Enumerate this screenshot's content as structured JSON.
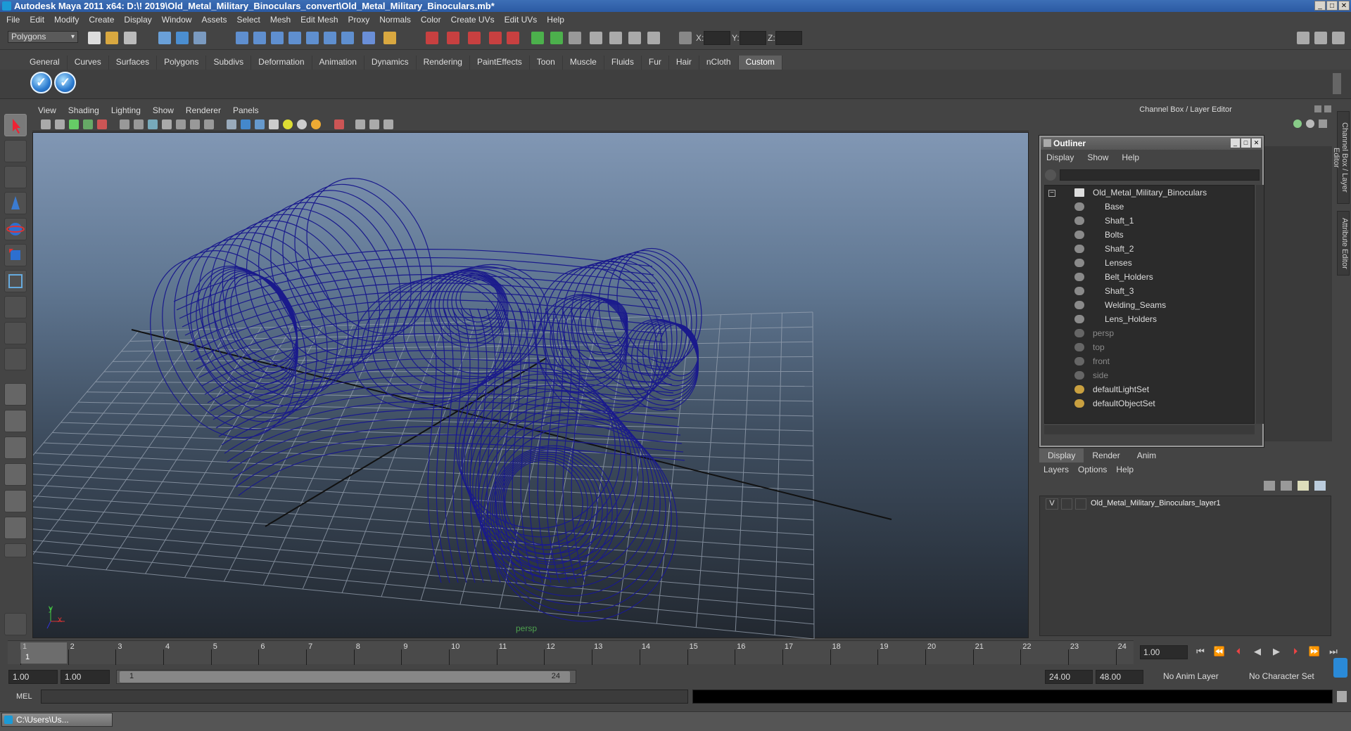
{
  "window": {
    "title": "Autodesk Maya 2011 x64: D:\\! 2019\\Old_Metal_Military_Binoculars_convert\\Old_Metal_Military_Binoculars.mb*"
  },
  "menubar": [
    "File",
    "Edit",
    "Modify",
    "Create",
    "Display",
    "Window",
    "Assets",
    "Select",
    "Mesh",
    "Edit Mesh",
    "Proxy",
    "Normals",
    "Color",
    "Create UVs",
    "Edit UVs",
    "Help"
  ],
  "statusline": {
    "mode": "Polygons",
    "x_label": "X:",
    "y_label": "Y:",
    "z_label": "Z:"
  },
  "shelf": {
    "tabs": [
      "General",
      "Curves",
      "Surfaces",
      "Polygons",
      "Subdivs",
      "Deformation",
      "Animation",
      "Dynamics",
      "Rendering",
      "PaintEffects",
      "Toon",
      "Muscle",
      "Fluids",
      "Fur",
      "Hair",
      "nCloth",
      "Custom"
    ],
    "active_tab": "Custom"
  },
  "viewport": {
    "menu": [
      "View",
      "Shading",
      "Lighting",
      "Show",
      "Renderer",
      "Panels"
    ],
    "camera": "persp",
    "axis_y": "y",
    "axis_x": "x",
    "wire_color": "#1a1a8c"
  },
  "channelbox": {
    "title": "Channel Box / Layer Editor",
    "side_tabs": [
      "Channel Box / Layer Editor",
      "Attribute Editor"
    ]
  },
  "outliner": {
    "title": "Outliner",
    "menu": [
      "Display",
      "Show",
      "Help"
    ],
    "root": "Old_Metal_Military_Binoculars",
    "children": [
      "Base",
      "Shaft_1",
      "Bolts",
      "Shaft_2",
      "Lenses",
      "Belt_Holders",
      "Shaft_3",
      "Welding_Seams",
      "Lens_Holders"
    ],
    "cameras": [
      "persp",
      "top",
      "front",
      "side"
    ],
    "sets": [
      "defaultLightSet",
      "defaultObjectSet"
    ]
  },
  "layers": {
    "tabs": [
      "Display",
      "Render",
      "Anim"
    ],
    "active_tab": "Display",
    "menu": [
      "Layers",
      "Options",
      "Help"
    ],
    "visibility": "V",
    "layer_name": "Old_Metal_Military_Binoculars_layer1"
  },
  "timeline": {
    "ticks": [
      "1",
      "2",
      "3",
      "4",
      "5",
      "6",
      "7",
      "8",
      "9",
      "10",
      "11",
      "12",
      "13",
      "14",
      "15",
      "16",
      "17",
      "18",
      "19",
      "20",
      "21",
      "22",
      "23",
      "24"
    ],
    "current_frame": "1.00",
    "playhead": "1"
  },
  "range": {
    "start": "1.00",
    "playback_start": "1.00",
    "slider_start": "1",
    "slider_end": "24",
    "playback_end": "24.00",
    "end": "48.00",
    "anim_layer": "No Anim Layer",
    "character_set": "No Character Set"
  },
  "mel": {
    "label": "MEL"
  },
  "taskbar": {
    "item": "C:\\Users\\Us..."
  }
}
